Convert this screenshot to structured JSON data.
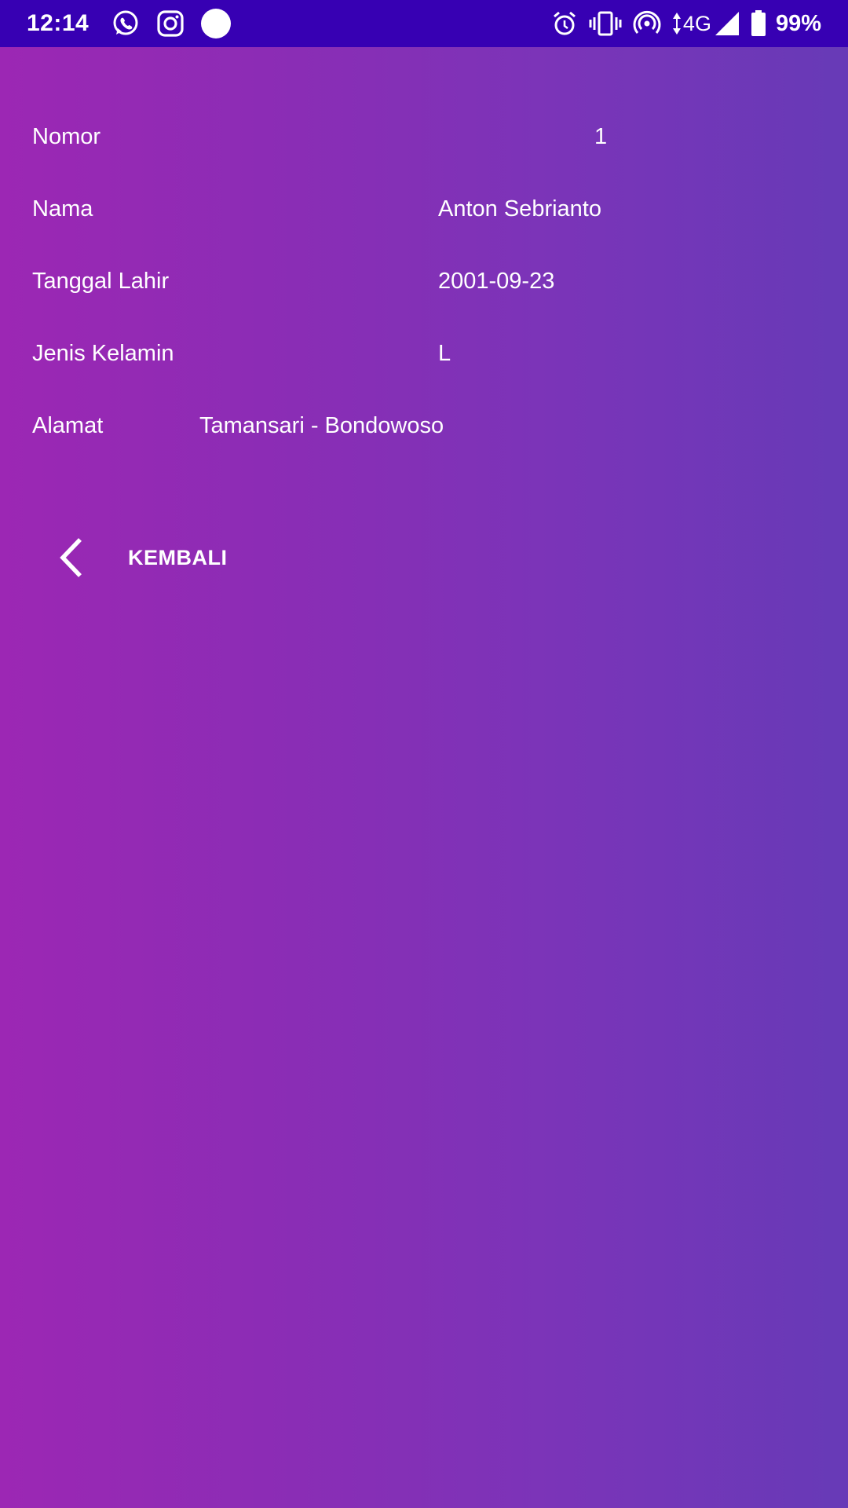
{
  "status_bar": {
    "time": "12:14",
    "left_icons": [
      "whatsapp-icon",
      "instagram-icon",
      "circle-notification-icon"
    ],
    "right_icons": [
      "alarm-icon",
      "vibrate-icon",
      "hotspot-icon",
      "data-arrows-icon",
      "signal-icon",
      "battery-icon"
    ],
    "network": "4G",
    "battery": "99%",
    "background": "#3700b3"
  },
  "detail": {
    "nomor_label": "Nomor",
    "nomor_value": "1",
    "nama_label": "Nama",
    "nama_value": "Anton Sebrianto",
    "tanggal_label": "Tanggal Lahir",
    "tanggal_value": "2001-09-23",
    "jenis_label": "Jenis Kelamin",
    "jenis_value": "L",
    "alamat_label": "Alamat",
    "alamat_value": "Tamansari - Bondowoso"
  },
  "actions": {
    "back_label": "KEMBALI",
    "back_icon": "chevron-left-icon"
  },
  "colors": {
    "gradient_start": "#9c27b4",
    "gradient_end": "#673ab7",
    "text": "#ffffff"
  }
}
